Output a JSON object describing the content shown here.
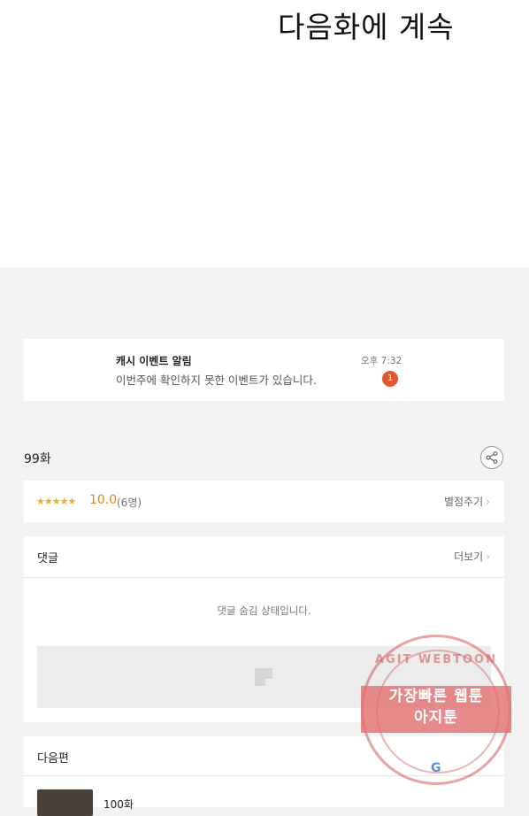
{
  "comic": {
    "to_be_continued": "다음화에 계속"
  },
  "notification": {
    "title": "캐시 이벤트 알림",
    "message": "이번주에 확인하지 못한 이벤트가 있습니다.",
    "time": "오후 7:32",
    "badge_count": "1"
  },
  "episode": {
    "label": "99화"
  },
  "rating": {
    "stars": "★★★★★",
    "score": "10.0",
    "count": "(6명)",
    "rate_label": "별점주기"
  },
  "comments": {
    "title": "댓글",
    "more_label": "더보기",
    "hidden_message": "댓글 숨김 상태입니다."
  },
  "next_episode": {
    "title": "다음편",
    "episode_label": "100화"
  },
  "watermark": {
    "top_text": "AGIT WEBTOON",
    "line1": "가장빠른 웹툰",
    "line2": "아지툰"
  },
  "colors": {
    "badge": "#e4572e",
    "star": "#f5a623",
    "score": "#f08a00",
    "watermark": "#d65a5a"
  },
  "icons": {
    "share": "share-icon",
    "chevron": "chevron-right-icon",
    "image_placeholder": "image-placeholder-icon"
  }
}
